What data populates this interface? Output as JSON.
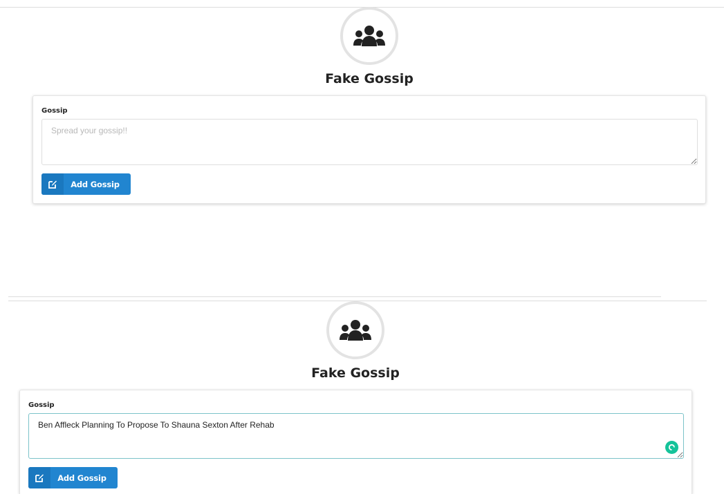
{
  "panels": [
    {
      "title": "Fake Gossip",
      "field_label": "Gossip",
      "textarea_value": "",
      "textarea_placeholder": "Spread your gossip!!",
      "button_label": "Add Gossip"
    },
    {
      "title": "Fake Gossip",
      "field_label": "Gossip",
      "textarea_value": "Ben Affleck Planning To Propose To Shauna Sexton After Rehab",
      "textarea_placeholder": "Spread your gossip!!",
      "button_label": "Add Gossip"
    }
  ],
  "icons": {
    "avatar": "users-group-icon",
    "button": "edit-square-icon",
    "grammar": "grammarly-icon"
  },
  "colors": {
    "button": "#2185d0",
    "button_icon_bg": "#1a78bf",
    "grammar_badge": "#15c39a",
    "avatar_border": "#e3e3e3"
  }
}
